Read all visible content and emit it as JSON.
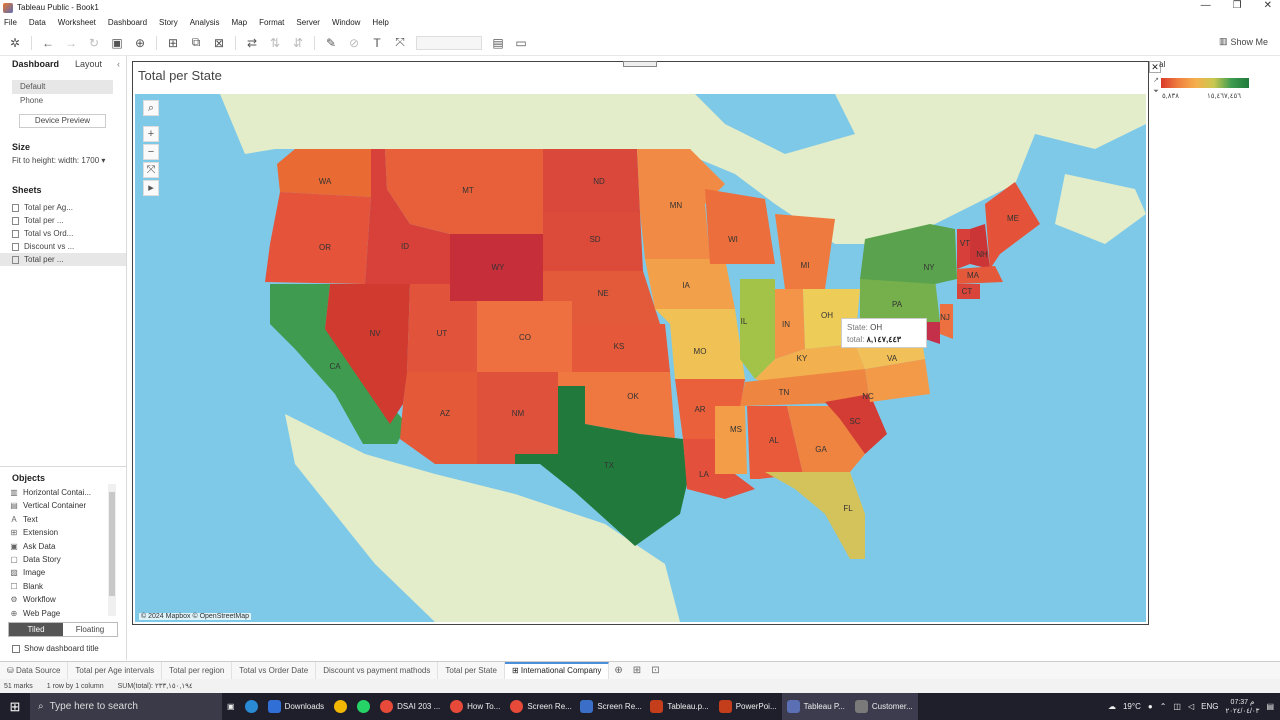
{
  "window": {
    "title": "Tableau Public - Book1",
    "controls": [
      "—",
      "❐",
      "✕"
    ]
  },
  "menu": [
    "File",
    "Data",
    "Worksheet",
    "Dashboard",
    "Story",
    "Analysis",
    "Map",
    "Format",
    "Server",
    "Window",
    "Help"
  ],
  "toolbar": {
    "show_me": "Show Me"
  },
  "sidebar": {
    "tabs": {
      "dashboard": "Dashboard",
      "layout": "Layout"
    },
    "devices": [
      "Default",
      "Phone"
    ],
    "device_preview": "Device Preview",
    "size": {
      "title": "Size",
      "value": "Fit to height: width: 1700"
    },
    "sheets": {
      "title": "Sheets",
      "items": [
        "Total per Ag...",
        "Total per ...",
        "Total vs Ord...",
        "Discount vs ...",
        "Total per ..."
      ]
    },
    "objects": {
      "title": "Objects",
      "items": [
        "Horizontal Contai...",
        "Vertical Container",
        "Text",
        "Extension",
        "Ask Data",
        "Data Story",
        "Image",
        "Blank",
        "Workflow",
        "Web Page"
      ]
    },
    "tiled": "Tiled",
    "floating": "Floating",
    "show_title": "Show dashboard title"
  },
  "dashboard": {
    "title": "Total per State",
    "attribution": "© 2024 Mapbox © OpenStreetMap",
    "tooltip": {
      "state_label": "State:",
      "state_value": "OH",
      "total_label": "total:",
      "total_value": "٨,١٤٧,٤٤٣"
    },
    "states": [
      "WA",
      "OR",
      "CA",
      "ID",
      "NV",
      "MT",
      "WY",
      "UT",
      "AZ",
      "CO",
      "NM",
      "ND",
      "SD",
      "NE",
      "KS",
      "OK",
      "TX",
      "MN",
      "IA",
      "MO",
      "AR",
      "LA",
      "WI",
      "IL",
      "MI",
      "IN",
      "OH",
      "KY",
      "TN",
      "MS",
      "AL",
      "GA",
      "FL",
      "SC",
      "NC",
      "VA",
      "PA",
      "NY",
      "VT",
      "NH",
      "MA",
      "CT",
      "ME",
      "NJ"
    ]
  },
  "legend": {
    "title": "al",
    "min": "٥,٨٣٨",
    "max": "١٥,٤٦٧,٤٥٦",
    "colors": {
      "low": "#d93a2b",
      "high": "#217a3b"
    }
  },
  "sheet_tabs": [
    "Data Source",
    "Total per Age intervals",
    "Total per region",
    "Total vs Order Date",
    "Discount vs payment mathods",
    "Total per State",
    "International Company"
  ],
  "status": {
    "marks": "51 marks",
    "rows": "1 row by 1 column",
    "sum": "SUM(total): ٢٣٣,١٥٠,١٩٤"
  },
  "taskbar": {
    "search": "Type here to search",
    "apps": [
      "Downloads",
      "DSAI 203 ...",
      "How To...",
      "Screen Re...",
      "Screen Re...",
      "Tableau.p...",
      "PowerPoi...",
      "Tableau P...",
      "Customer..."
    ],
    "temp": "19°C",
    "lang": "ENG",
    "time": "07:37 م",
    "date": "٢٠٢٤/٠٤/٠٣"
  }
}
